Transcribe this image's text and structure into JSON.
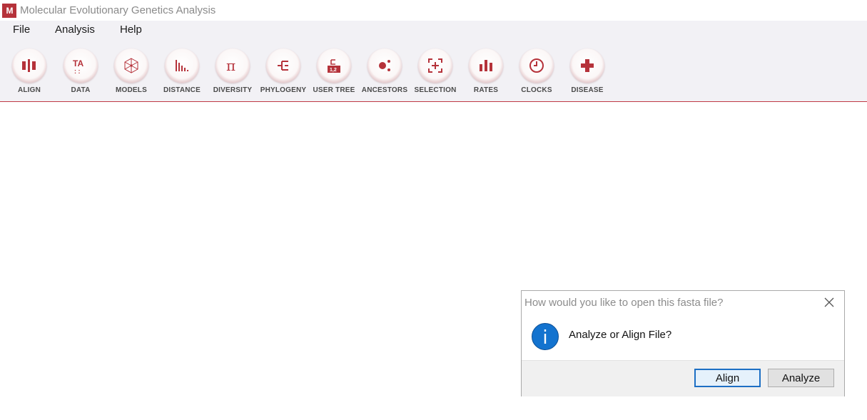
{
  "window": {
    "title": "Molecular Evolutionary Genetics Analysis",
    "logo": "M"
  },
  "menu": [
    "File",
    "Analysis",
    "Help"
  ],
  "toolbar": [
    {
      "label": "ALIGN",
      "icon": "align-icon"
    },
    {
      "label": "DATA",
      "icon": "data-icon"
    },
    {
      "label": "MODELS",
      "icon": "models-icon"
    },
    {
      "label": "DISTANCE",
      "icon": "distance-icon"
    },
    {
      "label": "DIVERSITY",
      "icon": "diversity-icon"
    },
    {
      "label": "PHYLOGENY",
      "icon": "phylogeny-icon"
    },
    {
      "label": "USER TREE",
      "icon": "user-tree-icon"
    },
    {
      "label": "ANCESTORS",
      "icon": "ancestors-icon"
    },
    {
      "label": "SELECTION",
      "icon": "selection-icon"
    },
    {
      "label": "RATES",
      "icon": "rates-icon"
    },
    {
      "label": "CLOCKS",
      "icon": "clocks-icon"
    },
    {
      "label": "DISEASE",
      "icon": "disease-icon"
    }
  ],
  "colors": {
    "accent": "#b5323a",
    "toolbar_bg": "#f2f1f5",
    "info_blue": "#1373cf"
  },
  "dialog": {
    "title": "How would you like to open this fasta file?",
    "message": "Analyze or Align File?",
    "buttons": {
      "align": "Align",
      "analyze": "Analyze"
    },
    "icon": "info-icon"
  }
}
